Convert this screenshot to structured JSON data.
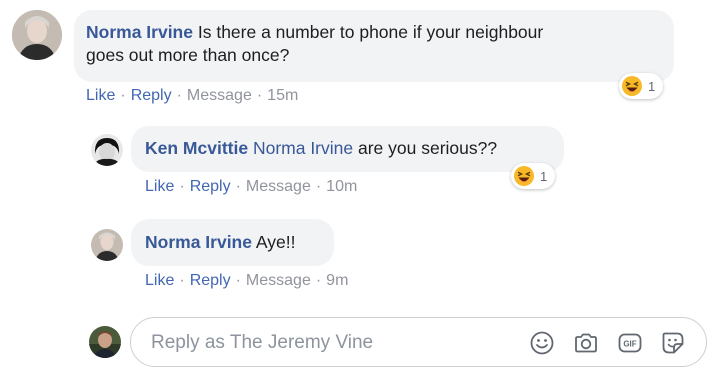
{
  "comments": [
    {
      "author": "Norma Irvine",
      "text_line1": "Is there a number to phone if your neighbour",
      "text_line2": "goes out more than once?",
      "actions": {
        "like": "Like",
        "reply": "Reply",
        "message": "Message",
        "time": "15m"
      },
      "reaction": {
        "icon": "laughing-emoji",
        "count": "1"
      }
    },
    {
      "author": "Ken Mcvittie",
      "mention": "Norma Irvine",
      "text": "are you serious??",
      "actions": {
        "like": "Like",
        "reply": "Reply",
        "message": "Message",
        "time": "10m"
      },
      "reaction": {
        "icon": "laughing-emoji",
        "count": "1"
      }
    },
    {
      "author": "Norma Irvine",
      "text": "Aye!!",
      "actions": {
        "like": "Like",
        "reply": "Reply",
        "message": "Message",
        "time": "9m"
      }
    }
  ],
  "reply_box": {
    "placeholder": "Reply as The Jeremy Vine",
    "tools": [
      "smiley-icon",
      "camera-icon",
      "gif-icon",
      "sticker-icon"
    ]
  },
  "colors": {
    "link": "#385898",
    "action_link": "#4267b2",
    "bubble": "#f2f3f5",
    "meta": "#90949c",
    "emoji": "#f7b928"
  }
}
